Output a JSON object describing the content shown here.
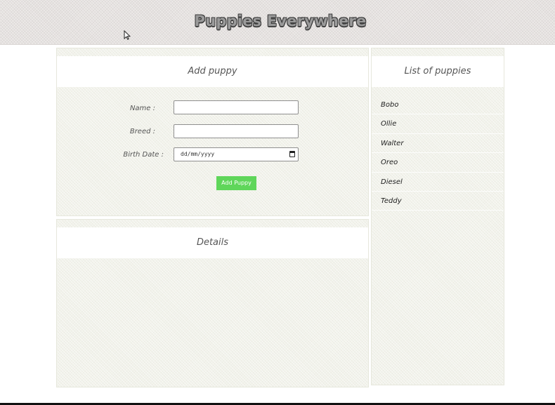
{
  "header": {
    "title": "Puppies Everywhere"
  },
  "add_puppy": {
    "title": "Add puppy",
    "fields": {
      "name_label": "Name :",
      "name_value": "",
      "breed_label": "Breed :",
      "breed_value": "",
      "birth_label": "Birth Date :",
      "birth_placeholder": "dd/mm/yyyy"
    },
    "submit_label": "Add Puppy"
  },
  "details": {
    "title": "Details"
  },
  "puppy_list": {
    "title": "List of puppies",
    "items": [
      "Bobo",
      "Ollie",
      "Walter",
      "Oreo",
      "Diesel",
      "Teddy"
    ]
  },
  "colors": {
    "header_bg": "#e6e2e0",
    "panel_bg": "#f1f2ea",
    "button_bg": "#5fd65a"
  },
  "icons": {
    "cursor": "arrow-cursor-icon",
    "date": "calendar-icon"
  }
}
